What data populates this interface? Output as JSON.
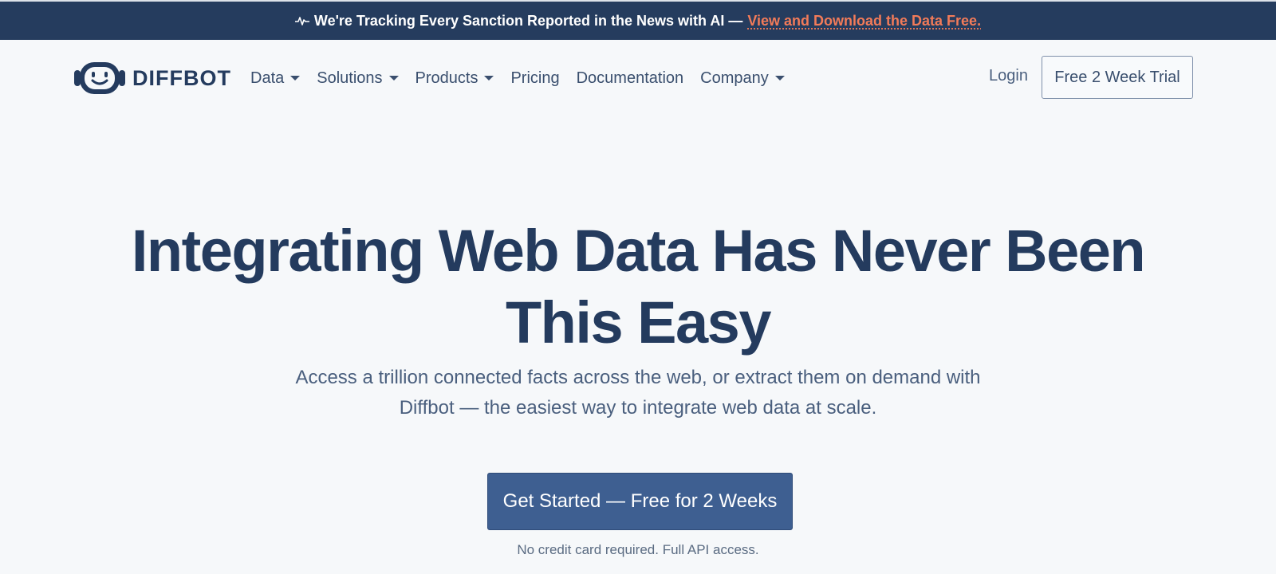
{
  "announcement": {
    "icon": "pulse-icon",
    "text": "We're Tracking Every Sanction Reported in the News with AI —",
    "link_text": "View and Download the Data Free."
  },
  "brand": {
    "logo_icon": "robot-face-icon",
    "name": "DIFFBOT"
  },
  "nav": {
    "items": [
      {
        "label": "Data",
        "dropdown": true
      },
      {
        "label": "Solutions",
        "dropdown": true
      },
      {
        "label": "Products",
        "dropdown": true
      },
      {
        "label": "Pricing",
        "dropdown": false
      },
      {
        "label": "Documentation",
        "dropdown": false
      },
      {
        "label": "Company",
        "dropdown": true
      }
    ],
    "login_label": "Login",
    "trial_label": "Free 2 Week Trial"
  },
  "hero": {
    "title": "Integrating Web Data Has Never Been This Easy",
    "subtitle": "Access a trillion connected facts across the web, or extract them on demand with Diffbot — the easiest way to integrate web data at scale.",
    "cta_label": "Get Started — Free for 2 Weeks",
    "note": "No credit card required. Full API access."
  },
  "colors": {
    "banner_bg": "#253c5e",
    "accent_link": "#f27b59",
    "primary_text": "#243b5e",
    "cta_bg": "#3e5f91",
    "page_bg": "#f6f8fa"
  }
}
